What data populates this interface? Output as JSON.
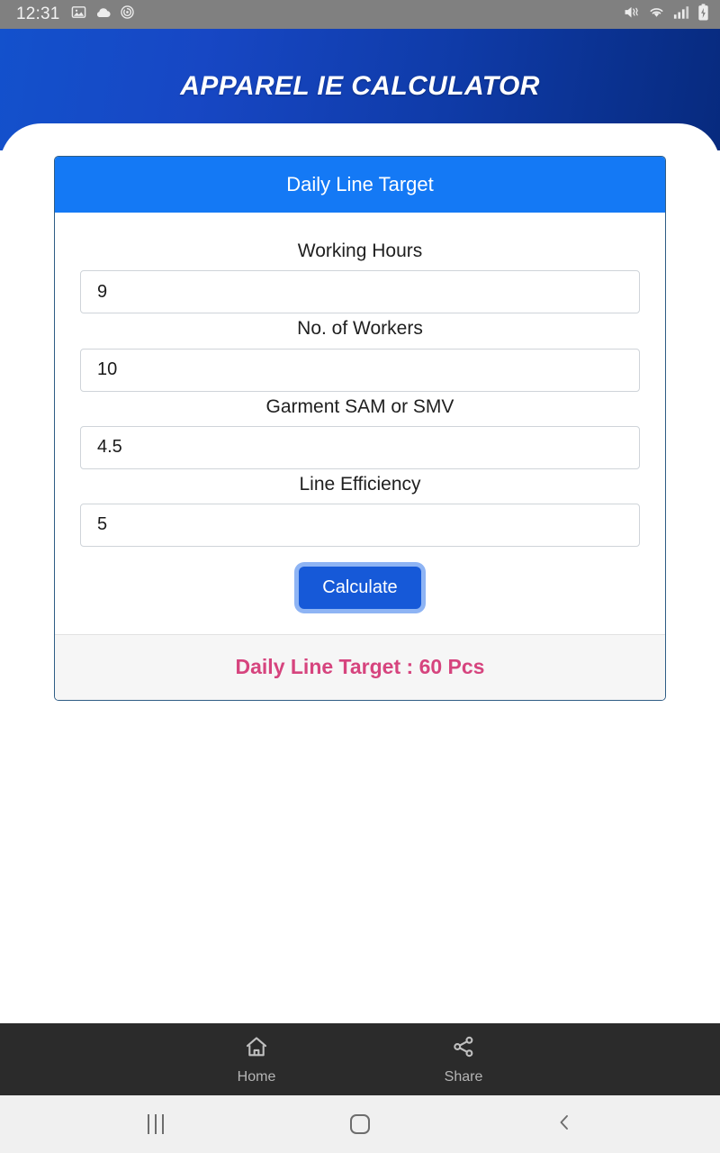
{
  "status_bar": {
    "time": "12:31",
    "left_icons": [
      "image-icon",
      "cloud-icon",
      "sync-circle-icon"
    ],
    "right_icons": [
      "mute-vibrate-icon",
      "wifi-icon",
      "signal-bars-icon",
      "battery-charging-icon"
    ]
  },
  "header": {
    "title": "APPAREL IE CALCULATOR"
  },
  "card": {
    "title": "Daily Line Target",
    "fields": [
      {
        "label": "Working Hours",
        "value": "9",
        "placeholder": "Working Hours"
      },
      {
        "label": "No. of Workers",
        "value": "10",
        "placeholder": "No. of Workers"
      },
      {
        "label": "Garment SAM or SMV",
        "value": "4.5",
        "placeholder": "Garment SAM or SMV"
      },
      {
        "label": "Line Efficiency",
        "value": "5",
        "placeholder": "Line Efficiency"
      }
    ],
    "calculate_label": "Calculate",
    "result": "Daily Line Target : 60 Pcs"
  },
  "bottom_bar": {
    "items": [
      {
        "label": "Home",
        "icon": "home-icon"
      },
      {
        "label": "Share",
        "icon": "share-icon"
      }
    ]
  },
  "nav_bar": {
    "recents": "recents-icon",
    "home": "home-square-icon",
    "back": "back-chevron-icon"
  },
  "colors": {
    "header_blue": "#0f3ba8",
    "card_header_blue": "#1479f5",
    "button_blue": "#1659d8",
    "result_pink": "#d6447e",
    "status_gray": "#808080",
    "bottom_bar_dark": "#2b2b2b"
  }
}
